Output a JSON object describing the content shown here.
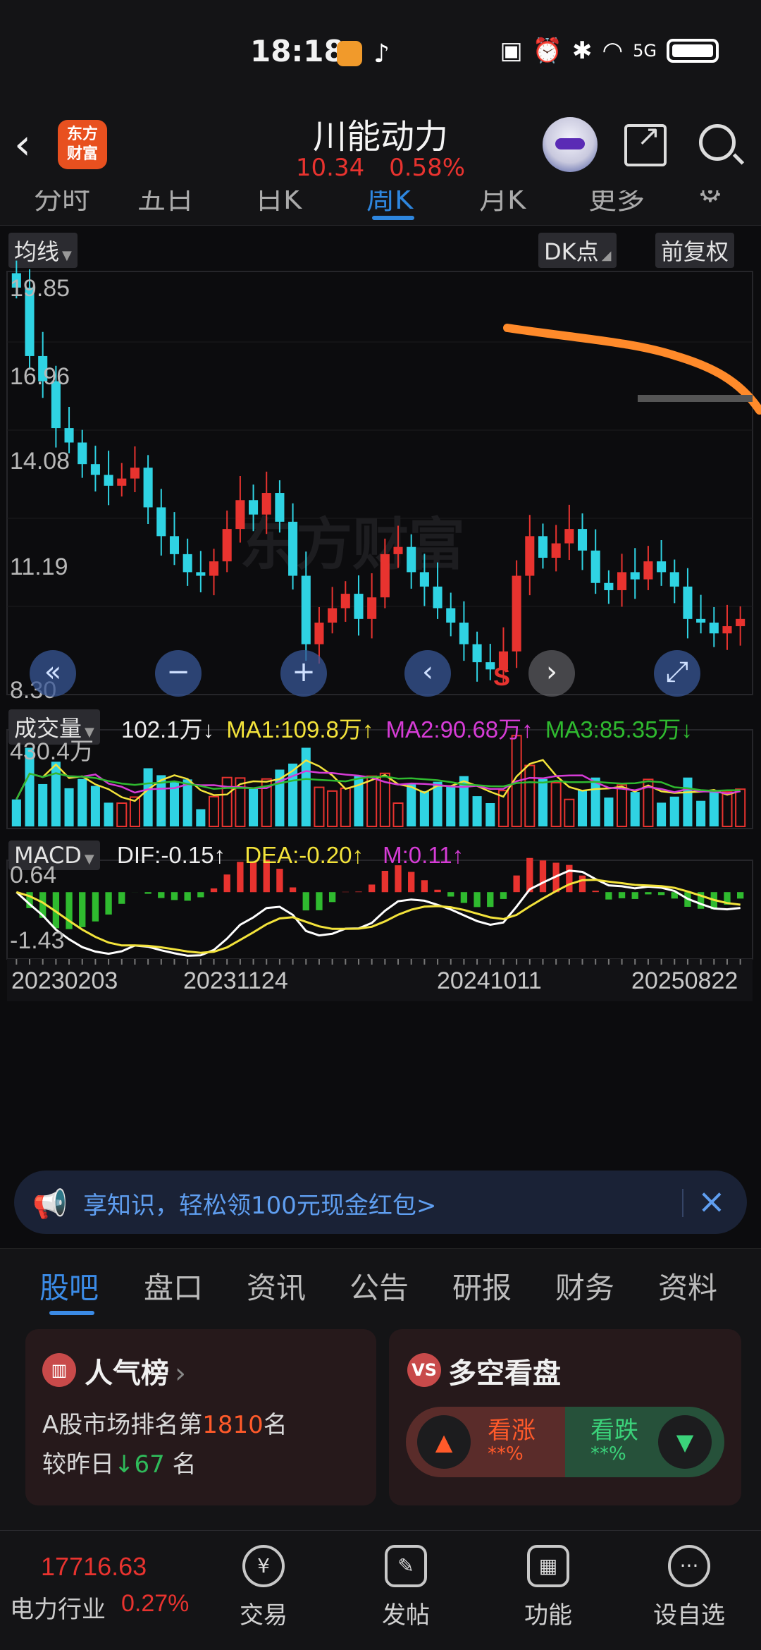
{
  "status_bar": {
    "time": "18:18",
    "signal": "5G"
  },
  "header": {
    "title": "川能动力",
    "price": "10.34",
    "change_pct": "0.58%",
    "logo_line1": "东方",
    "logo_line2": "财富"
  },
  "period_tabs": [
    "分时",
    "五日",
    "日K",
    "周K",
    "月K",
    "更多"
  ],
  "period_active": "周K",
  "chart_controls": {
    "ma_label": "均线",
    "dk_label": "DK点",
    "adjust_label": "前复权",
    "watermark": "东方财富",
    "signal_marker": "S"
  },
  "price_axis": [
    "19.85",
    "16.96",
    "14.08",
    "11.19",
    "8.30"
  ],
  "volume": {
    "label": "成交量",
    "current": "102.1万↓",
    "ma1": "MA1:109.8万↑",
    "ma2": "MA2:90.68万↑",
    "ma3": "MA3:85.35万↓",
    "axis_max": "430.4万"
  },
  "macd": {
    "label": "MACD",
    "dif": "DIF:-0.15↑",
    "dea": "DEA:-0.20↑",
    "m": "M:0.11↑",
    "axis_max": "0.64",
    "axis_min": "-1.43"
  },
  "dates": [
    "20230203",
    "20231124",
    "20241011",
    "20250822"
  ],
  "banner": {
    "text": "享知识，轻松领100元现金红包>"
  },
  "info_tabs": [
    "股吧",
    "盘口",
    "资讯",
    "公告",
    "研报",
    "财务",
    "资料"
  ],
  "popularity_card": {
    "title": "人气榜",
    "rank_prefix": "A股市场排名第",
    "rank": "1810",
    "rank_suffix": "名",
    "change_prefix": "较昨日",
    "change_value": "67",
    "change_suffix": "名"
  },
  "sentiment_card": {
    "title": "多空看盘",
    "bull_label": "看涨",
    "bull_value": "**%",
    "bear_label": "看跌",
    "bear_value": "**%"
  },
  "bottom_bar": {
    "index_value": "17716.63",
    "index_name": "电力行业",
    "index_pct": "0.27%",
    "nav": [
      "交易",
      "发帖",
      "功能",
      "设自选"
    ]
  },
  "colors": {
    "up": "#e8332f",
    "down": "#2fd3e3",
    "accent": "#2e86de",
    "ma1": "#f3e33b",
    "ma2": "#d63cd6",
    "ma3": "#2fba2f",
    "annotation": "#ff8a2a"
  },
  "chart_data": {
    "type": "candlestick",
    "period": "weekly",
    "price_range": [
      8.3,
      19.85
    ],
    "macd_range": [
      -1.43,
      0.64
    ],
    "volume_max": "430.4万",
    "x_labels": [
      "20230203",
      "20231124",
      "20241011",
      "20250822"
    ],
    "close_approx": [
      19.5,
      17.6,
      16.9,
      15.6,
      15.2,
      14.6,
      14.3,
      14.0,
      14.2,
      14.5,
      13.4,
      12.6,
      12.1,
      11.6,
      11.5,
      11.9,
      12.8,
      13.6,
      13.2,
      13.8,
      13.0,
      11.5,
      9.6,
      10.2,
      10.6,
      11.0,
      10.3,
      10.9,
      12.1,
      12.3,
      11.6,
      11.2,
      10.6,
      10.2,
      9.6,
      9.1,
      8.9,
      9.4,
      11.5,
      12.6,
      12.0,
      12.4,
      12.8,
      12.2,
      11.3,
      11.1,
      11.6,
      11.4,
      11.9,
      11.6,
      11.2,
      10.3,
      10.2,
      9.9,
      10.1,
      10.3
    ],
    "annotations": [
      "orange hand-drawn descending line",
      "grey horizontal line near 11.0"
    ]
  }
}
